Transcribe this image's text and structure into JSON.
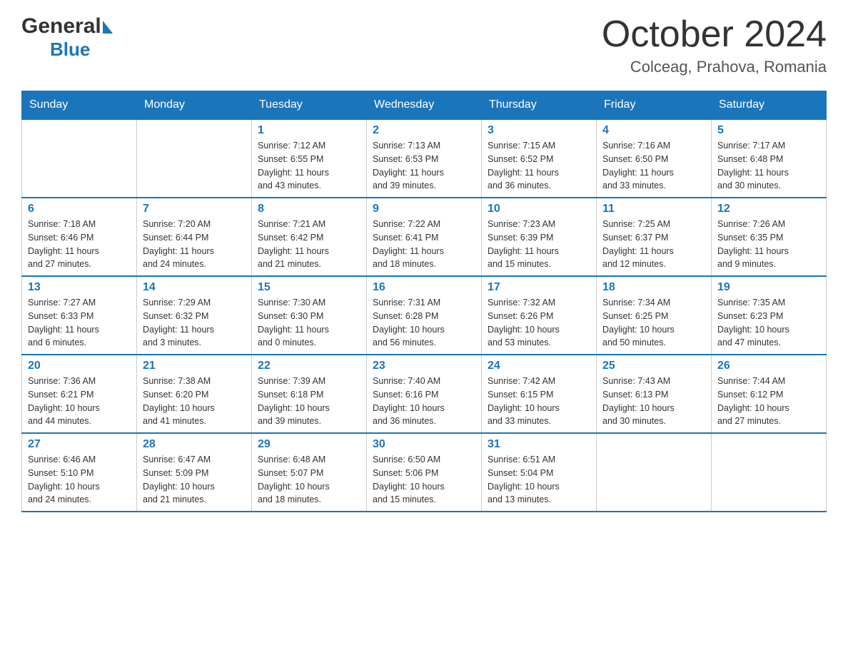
{
  "logo": {
    "general": "General",
    "blue": "Blue"
  },
  "title": "October 2024",
  "subtitle": "Colceag, Prahova, Romania",
  "days": [
    "Sunday",
    "Monday",
    "Tuesday",
    "Wednesday",
    "Thursday",
    "Friday",
    "Saturday"
  ],
  "weeks": [
    [
      {
        "day": "",
        "info": ""
      },
      {
        "day": "",
        "info": ""
      },
      {
        "day": "1",
        "info": "Sunrise: 7:12 AM\nSunset: 6:55 PM\nDaylight: 11 hours\nand 43 minutes."
      },
      {
        "day": "2",
        "info": "Sunrise: 7:13 AM\nSunset: 6:53 PM\nDaylight: 11 hours\nand 39 minutes."
      },
      {
        "day": "3",
        "info": "Sunrise: 7:15 AM\nSunset: 6:52 PM\nDaylight: 11 hours\nand 36 minutes."
      },
      {
        "day": "4",
        "info": "Sunrise: 7:16 AM\nSunset: 6:50 PM\nDaylight: 11 hours\nand 33 minutes."
      },
      {
        "day": "5",
        "info": "Sunrise: 7:17 AM\nSunset: 6:48 PM\nDaylight: 11 hours\nand 30 minutes."
      }
    ],
    [
      {
        "day": "6",
        "info": "Sunrise: 7:18 AM\nSunset: 6:46 PM\nDaylight: 11 hours\nand 27 minutes."
      },
      {
        "day": "7",
        "info": "Sunrise: 7:20 AM\nSunset: 6:44 PM\nDaylight: 11 hours\nand 24 minutes."
      },
      {
        "day": "8",
        "info": "Sunrise: 7:21 AM\nSunset: 6:42 PM\nDaylight: 11 hours\nand 21 minutes."
      },
      {
        "day": "9",
        "info": "Sunrise: 7:22 AM\nSunset: 6:41 PM\nDaylight: 11 hours\nand 18 minutes."
      },
      {
        "day": "10",
        "info": "Sunrise: 7:23 AM\nSunset: 6:39 PM\nDaylight: 11 hours\nand 15 minutes."
      },
      {
        "day": "11",
        "info": "Sunrise: 7:25 AM\nSunset: 6:37 PM\nDaylight: 11 hours\nand 12 minutes."
      },
      {
        "day": "12",
        "info": "Sunrise: 7:26 AM\nSunset: 6:35 PM\nDaylight: 11 hours\nand 9 minutes."
      }
    ],
    [
      {
        "day": "13",
        "info": "Sunrise: 7:27 AM\nSunset: 6:33 PM\nDaylight: 11 hours\nand 6 minutes."
      },
      {
        "day": "14",
        "info": "Sunrise: 7:29 AM\nSunset: 6:32 PM\nDaylight: 11 hours\nand 3 minutes."
      },
      {
        "day": "15",
        "info": "Sunrise: 7:30 AM\nSunset: 6:30 PM\nDaylight: 11 hours\nand 0 minutes."
      },
      {
        "day": "16",
        "info": "Sunrise: 7:31 AM\nSunset: 6:28 PM\nDaylight: 10 hours\nand 56 minutes."
      },
      {
        "day": "17",
        "info": "Sunrise: 7:32 AM\nSunset: 6:26 PM\nDaylight: 10 hours\nand 53 minutes."
      },
      {
        "day": "18",
        "info": "Sunrise: 7:34 AM\nSunset: 6:25 PM\nDaylight: 10 hours\nand 50 minutes."
      },
      {
        "day": "19",
        "info": "Sunrise: 7:35 AM\nSunset: 6:23 PM\nDaylight: 10 hours\nand 47 minutes."
      }
    ],
    [
      {
        "day": "20",
        "info": "Sunrise: 7:36 AM\nSunset: 6:21 PM\nDaylight: 10 hours\nand 44 minutes."
      },
      {
        "day": "21",
        "info": "Sunrise: 7:38 AM\nSunset: 6:20 PM\nDaylight: 10 hours\nand 41 minutes."
      },
      {
        "day": "22",
        "info": "Sunrise: 7:39 AM\nSunset: 6:18 PM\nDaylight: 10 hours\nand 39 minutes."
      },
      {
        "day": "23",
        "info": "Sunrise: 7:40 AM\nSunset: 6:16 PM\nDaylight: 10 hours\nand 36 minutes."
      },
      {
        "day": "24",
        "info": "Sunrise: 7:42 AM\nSunset: 6:15 PM\nDaylight: 10 hours\nand 33 minutes."
      },
      {
        "day": "25",
        "info": "Sunrise: 7:43 AM\nSunset: 6:13 PM\nDaylight: 10 hours\nand 30 minutes."
      },
      {
        "day": "26",
        "info": "Sunrise: 7:44 AM\nSunset: 6:12 PM\nDaylight: 10 hours\nand 27 minutes."
      }
    ],
    [
      {
        "day": "27",
        "info": "Sunrise: 6:46 AM\nSunset: 5:10 PM\nDaylight: 10 hours\nand 24 minutes."
      },
      {
        "day": "28",
        "info": "Sunrise: 6:47 AM\nSunset: 5:09 PM\nDaylight: 10 hours\nand 21 minutes."
      },
      {
        "day": "29",
        "info": "Sunrise: 6:48 AM\nSunset: 5:07 PM\nDaylight: 10 hours\nand 18 minutes."
      },
      {
        "day": "30",
        "info": "Sunrise: 6:50 AM\nSunset: 5:06 PM\nDaylight: 10 hours\nand 15 minutes."
      },
      {
        "day": "31",
        "info": "Sunrise: 6:51 AM\nSunset: 5:04 PM\nDaylight: 10 hours\nand 13 minutes."
      },
      {
        "day": "",
        "info": ""
      },
      {
        "day": "",
        "info": ""
      }
    ]
  ]
}
